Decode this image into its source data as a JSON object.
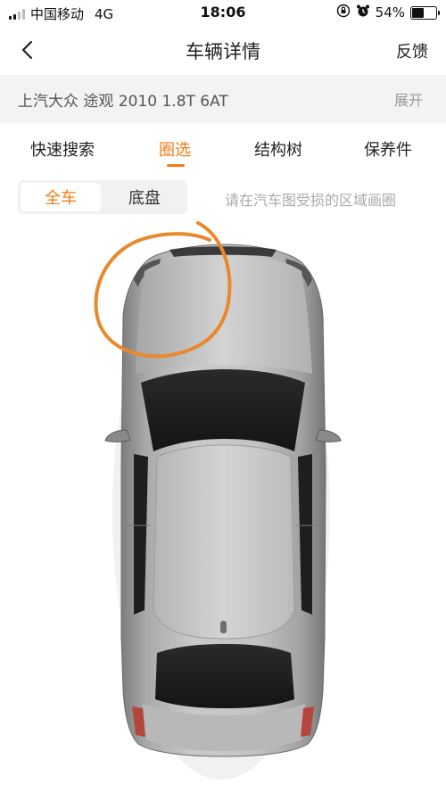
{
  "status_bar": {
    "carrier": "中国移动",
    "network": "4G",
    "time": "18:06",
    "battery": "54%",
    "battery_level": 0.54
  },
  "nav": {
    "title": "车辆详情",
    "feedback": "反馈"
  },
  "vehicle": {
    "model": "上汽大众 途观 2010 1.8T 6AT",
    "expand": "展开"
  },
  "tabs": [
    {
      "label": "快速搜索",
      "active": false
    },
    {
      "label": "圈选",
      "active": true
    },
    {
      "label": "结构树",
      "active": false
    },
    {
      "label": "保养件",
      "active": false
    }
  ],
  "segment": {
    "options": [
      "全车",
      "底盘"
    ],
    "selected": "全车"
  },
  "hint": "请在汽车图受损的区域画圈",
  "colors": {
    "accent": "#f07d17",
    "background": "#ffffff",
    "model_bar": "#f3f3f3"
  },
  "icons": {
    "back": "chevron-left-icon",
    "lock": "orientation-lock-icon",
    "alarm": "alarm-clock-icon",
    "battery": "battery-icon"
  }
}
